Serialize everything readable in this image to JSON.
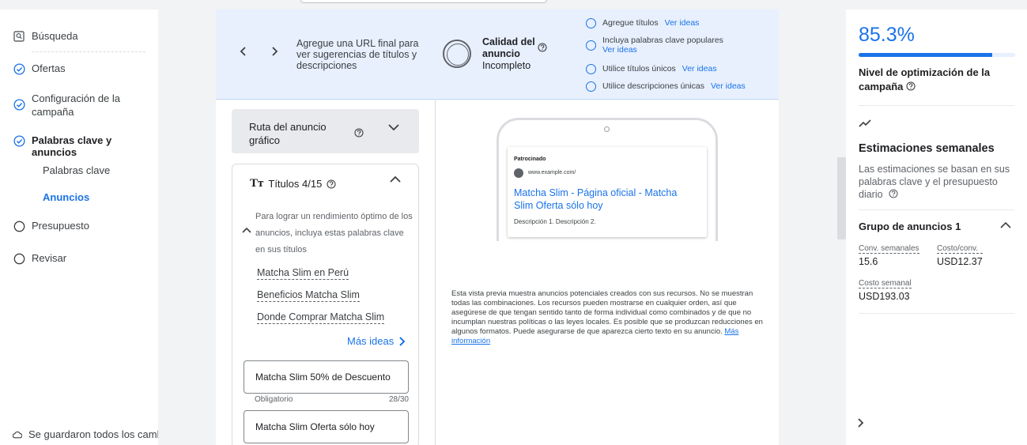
{
  "nav": {
    "items": [
      {
        "label": "Búsqueda",
        "icon": "search-box-icon"
      },
      {
        "label": "Ofertas",
        "icon": "check-circle-icon"
      },
      {
        "label": "Configuración de la campaña",
        "icon": "check-circle-icon"
      },
      {
        "label": "Palabras clave y anuncios",
        "icon": "check-circle-icon"
      },
      {
        "label": "Presupuesto",
        "icon": "empty-circle-icon"
      },
      {
        "label": "Revisar",
        "icon": "empty-circle-icon"
      }
    ],
    "sub": [
      {
        "label": "Palabras clave"
      },
      {
        "label": "Anuncios"
      }
    ],
    "saved_status": "Se guardaron todos los cambios"
  },
  "banner": {
    "url_hint": "Agregue una URL final para ver sugerencias de títulos y descripciones",
    "quality_title": "Calidad del anuncio",
    "quality_status": "Incompleto",
    "checks": [
      {
        "label": "Agregue títulos",
        "link": "Ver ideas"
      },
      {
        "label": "Incluya palabras clave populares",
        "link": "Ver ideas"
      },
      {
        "label": "Utilice títulos únicos",
        "link": "Ver ideas"
      },
      {
        "label": "Utilice descripciones únicas",
        "link": "Ver ideas"
      }
    ]
  },
  "editor": {
    "ruta_label": "Ruta del anuncio gráfico",
    "titles_label": "Títulos 4/15",
    "titles_icon_text": "Tт",
    "advice": "Para lograr un rendimiento óptimo de los anuncios, incluya estas palabras clave en sus títulos",
    "keywords": [
      "Matcha Slim en Perú",
      "Beneficios Matcha Slim",
      "Donde Comprar Matcha Slim"
    ],
    "more_ideas": "Más ideas",
    "fields": [
      {
        "value": "Matcha Slim 50% de Descuento",
        "meta_left": "Obligatorio",
        "meta_right": "28/30"
      },
      {
        "value": "Matcha Slim Oferta sólo hoy"
      }
    ]
  },
  "preview": {
    "sponsored": "Patrocinado",
    "url": "www.example.com/",
    "headline": "Matcha Slim - Página oficial - Matcha Slim Oferta sólo hoy",
    "description": "Descripción 1. Descripción 2.",
    "note": "Esta vista previa muestra anuncios potenciales creados con sus recursos. No se muestran todas las combinaciones. Los recursos pueden mostrarse en cualquier orden, así que asegúrese de que tengan sentido tanto de forma individual como combinados y de que no incumplan nuestras políticas o las leyes locales. Es posible que se produzcan reducciones en algunos formatos. Puede asegurarse de que aparezca cierto texto en su anuncio.",
    "note_link": "Más información"
  },
  "sidebar_right": {
    "score": "85.3%",
    "score_fraction": 0.853,
    "opt_label": "Nivel de optimización de la campaña",
    "est_title": "Estimaciones semanales",
    "est_desc": "Las estimaciones se basan en sus palabras clave y el presupuesto diario",
    "group_title": "Grupo de anuncios 1",
    "metrics": [
      {
        "label": "Conv. semanales",
        "value": "15.6"
      },
      {
        "label": "Costo/conv.",
        "value": "USD12.37"
      },
      {
        "label": "Costo semanal",
        "value": "USD193.03"
      }
    ]
  },
  "colors": {
    "accent": "#1a73e8",
    "banner_bg": "#e8f0fe",
    "text": "#202124"
  }
}
